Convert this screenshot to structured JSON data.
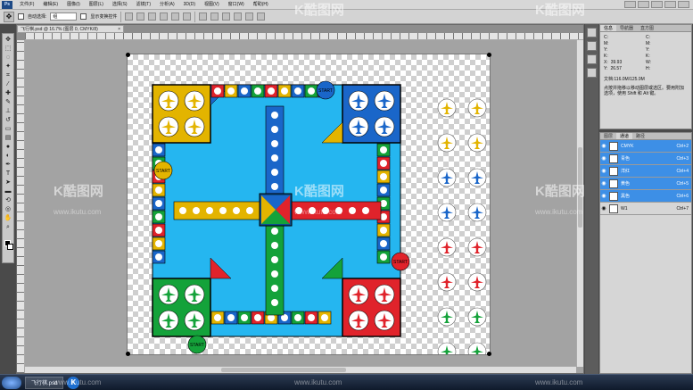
{
  "app": {
    "logo_text": "Ps"
  },
  "menu": {
    "items": [
      "文件(F)",
      "编辑(E)",
      "图像(I)",
      "图层(L)",
      "选择(S)",
      "滤镜(T)",
      "分析(A)",
      "3D(D)",
      "视图(V)",
      "窗口(W)",
      "帮助(H)"
    ]
  },
  "options": {
    "auto_select_label": "自动选择:",
    "auto_select_value": "组",
    "show_transform_label": "显示变换控件"
  },
  "document": {
    "tab_title": "飞行棋.psd @ 16.7% (图层 0, CMYK/8)",
    "close_glyph": "×"
  },
  "info_panel": {
    "tabs": [
      "信息",
      "导航器",
      "直方图"
    ],
    "readouts": [
      {
        "label": "C:",
        "value": ""
      },
      {
        "label": "C:",
        "value": ""
      },
      {
        "label": "M:",
        "value": ""
      },
      {
        "label": "M:",
        "value": ""
      },
      {
        "label": "Y:",
        "value": ""
      },
      {
        "label": "Y:",
        "value": ""
      },
      {
        "label": "K:",
        "value": ""
      },
      {
        "label": "K:",
        "value": ""
      },
      {
        "label": "X:",
        "value": "39.93"
      },
      {
        "label": "W:",
        "value": ""
      },
      {
        "label": "Y:",
        "value": "26.57"
      },
      {
        "label": "H:",
        "value": ""
      }
    ],
    "doc_size": "文档:116.0M/125.9M",
    "tip": "点按并拖移以移动图层或选区。要用附加选项，使用 Shift 和 Alt 键。"
  },
  "layers_panel": {
    "tabs": [
      "图层",
      "通道",
      "路径"
    ],
    "layers": [
      {
        "name": "CMYK",
        "shortcut": "Ctrl+2",
        "selected": true
      },
      {
        "name": "青色",
        "shortcut": "Ctrl+3",
        "selected": true
      },
      {
        "name": "洋红",
        "shortcut": "Ctrl+4",
        "selected": true
      },
      {
        "name": "黄色",
        "shortcut": "Ctrl+5",
        "selected": true
      },
      {
        "name": "黑色",
        "shortcut": "Ctrl+6",
        "selected": true
      },
      {
        "name": "W1",
        "shortcut": "Ctrl+7",
        "selected": false
      }
    ]
  },
  "board": {
    "start_labels": [
      "START",
      "START",
      "START",
      "START"
    ],
    "colors": {
      "yellow": "#e3b400",
      "blue": "#1a66c9",
      "green": "#14a23a",
      "red": "#e0232b",
      "cyan": "#25b6f0"
    }
  },
  "taskbar": {
    "task_label": "飞行棋.psd",
    "icon_letter": "K"
  },
  "watermark": {
    "brand": "K酷图网",
    "url": "www.ikutu.com"
  }
}
